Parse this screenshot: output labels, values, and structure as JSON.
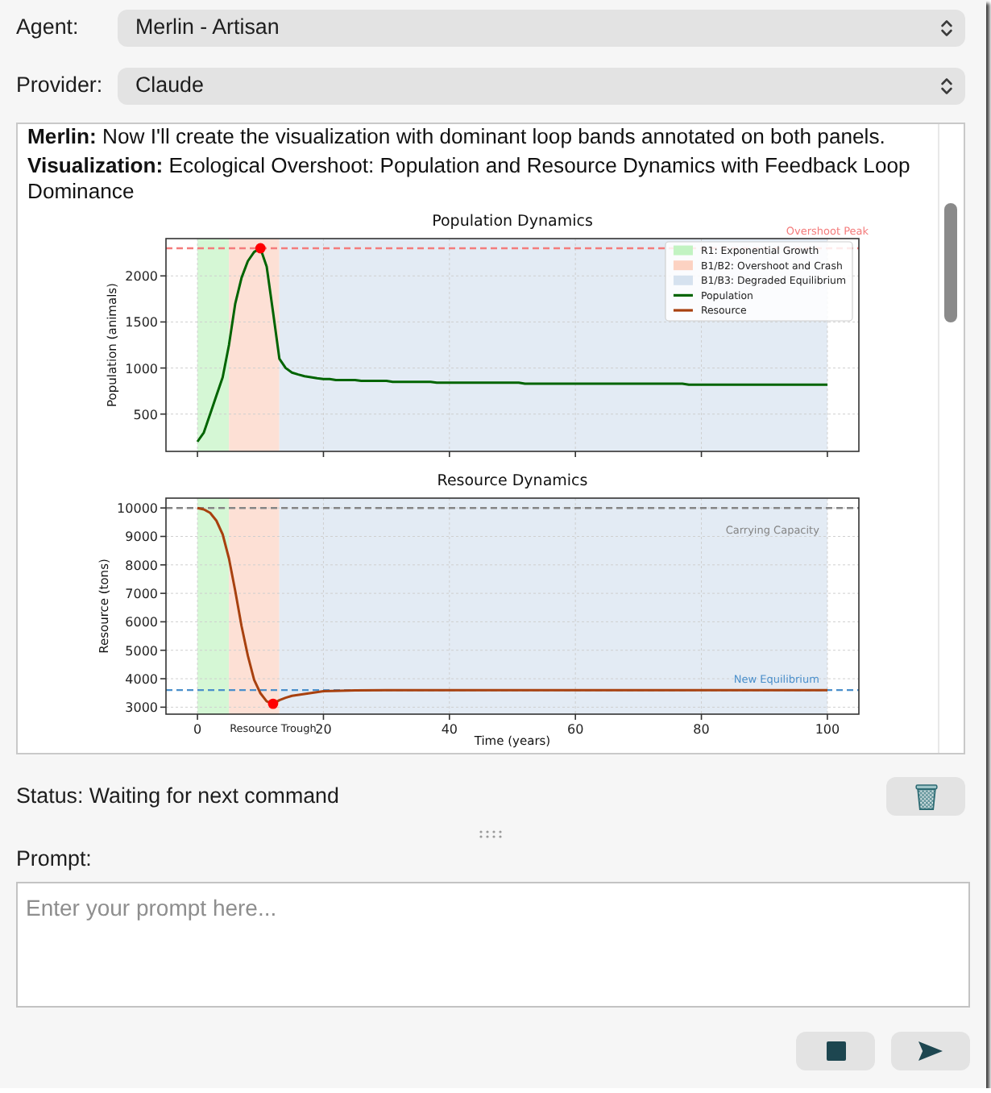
{
  "agent": {
    "label": "Agent:",
    "value": "Merlin - Artisan"
  },
  "provider": {
    "label": "Provider:",
    "value": "Claude"
  },
  "chat": {
    "messages": [
      "**Merlin:** Now I'll create the visualization with dominant loop bands annotated on both panels.",
      "**Visualization:** Ecological Overshoot: Population and Resource Dynamics with Feedback Loop Dominance"
    ],
    "charts": [
      {
        "legend": [
          {
            "kind": "patch",
            "label": "R1: Exponential Growth",
            "color": "#c2f3c2"
          },
          {
            "kind": "patch",
            "label": "B1/B2: Overshoot and Crash",
            "color": "#fcd2c2"
          },
          {
            "kind": "patch",
            "label": "B1/B3: Degraded Equilibrium",
            "color": "#d6e2ef"
          }
        ],
        "chart_data": {
          "type": "line",
          "title": "Population Dynamics",
          "ylabel": "Population (animals)",
          "categories": [
            null,
            null,
            null,
            null,
            null,
            null,
            null,
            null,
            null,
            null,
            null,
            null,
            null,
            null,
            null,
            null,
            null,
            null,
            null,
            null,
            null,
            null,
            null,
            null,
            null,
            null,
            null,
            null,
            null,
            null,
            null,
            null,
            null,
            null,
            null,
            null,
            null,
            null,
            null,
            null,
            null,
            null,
            null,
            null,
            null,
            null,
            null,
            null,
            null,
            null,
            null,
            null,
            null,
            null,
            null,
            null,
            null,
            null,
            null,
            null,
            null,
            null,
            null,
            null,
            null,
            null,
            null,
            null,
            null,
            null,
            null,
            null,
            null,
            null,
            null,
            null,
            null,
            null,
            null,
            null,
            null,
            null,
            null,
            null,
            null,
            null,
            null,
            null,
            null,
            null,
            null,
            null,
            null,
            null,
            null,
            null,
            null,
            null,
            null,
            null,
            null
          ],
          "series": [
            {
              "name": "Population",
              "color": "#006400",
              "values": [
                200,
                300,
                500,
                700,
                900,
                1250,
                1700,
                1980,
                2160,
                2260,
                2300,
                2100,
                1600,
                1100,
                1000,
                950,
                930,
                910,
                900,
                890,
                880,
                880,
                870,
                870,
                870,
                870,
                860,
                860,
                860,
                860,
                860,
                850,
                850,
                850,
                850,
                850,
                850,
                850,
                840,
                840,
                840,
                840,
                840,
                840,
                840,
                840,
                840,
                840,
                840,
                840,
                840,
                840,
                830,
                830,
                830,
                830,
                830,
                830,
                830,
                830,
                830,
                830,
                830,
                830,
                830,
                830,
                830,
                830,
                830,
                830,
                830,
                830,
                830,
                830,
                830,
                830,
                830,
                830,
                820,
                820,
                820,
                820,
                820,
                820,
                820,
                820,
                820,
                820,
                820,
                820,
                820,
                820,
                820,
                820,
                820,
                820,
                820,
                820,
                820,
                820,
                820
              ]
            }
          ],
          "ylim": [
            95,
            2405
          ],
          "yticks": [
            500,
            1000,
            1500,
            2000
          ],
          "grid": true,
          "ref_lines": [
            {
              "axis": "y",
              "value": 2300,
              "label": "Overshoot Peak",
              "color": "#f47c7c"
            }
          ]
        }
      },
      {
        "chart_data": {
          "type": "line",
          "title": "Resource Dynamics",
          "xlabel": "Time (years)",
          "ylabel": "Resource (tons)",
          "x": [
            0,
            1,
            2,
            3,
            4,
            5,
            6,
            7,
            8,
            9,
            10,
            11,
            12,
            13,
            14,
            15,
            20,
            25,
            30,
            40,
            50,
            60,
            70,
            80,
            90,
            100
          ],
          "series": [
            {
              "name": "Resource",
              "color": "#a8410f",
              "values": [
                10000,
                9950,
                9830,
                9550,
                9070,
                8220,
                7080,
                5850,
                4810,
                3960,
                3490,
                3200,
                3120,
                3250,
                3330,
                3400,
                3560,
                3590,
                3600,
                3600,
                3600,
                3600,
                3600,
                3600,
                3600,
                3600
              ]
            }
          ],
          "xlim": [
            -5,
            105
          ],
          "ylim": [
            2755,
            10345
          ],
          "xticks": [
            0,
            20,
            40,
            60,
            80,
            100
          ],
          "yticks": [
            3000,
            4000,
            5000,
            6000,
            7000,
            8000,
            9000,
            10000
          ],
          "grid": true,
          "bands": [
            {
              "axis": "x",
              "from": 0,
              "to": 5,
              "color": "#d5f7d5"
            },
            {
              "axis": "x",
              "from": 5,
              "to": 13,
              "color": "#fde0d5"
            },
            {
              "axis": "x",
              "from": 13,
              "to": 100,
              "color": "#e3ebf4"
            }
          ],
          "ref_lines": [
            {
              "axis": "y",
              "value": 10000,
              "label": "Carrying Capacity",
              "color": "#858585"
            },
            {
              "axis": "y",
              "value": 3600,
              "label": "New Equilibrium",
              "color": "#4a8fcb"
            }
          ],
          "annotations": [
            {
              "text": "Resource Trough",
              "x": 12,
              "y": 3120
            }
          ]
        }
      }
    ]
  },
  "status": "Status: Waiting for next command",
  "prompt": {
    "label": "Prompt:",
    "placeholder": "Enter your prompt here..."
  }
}
